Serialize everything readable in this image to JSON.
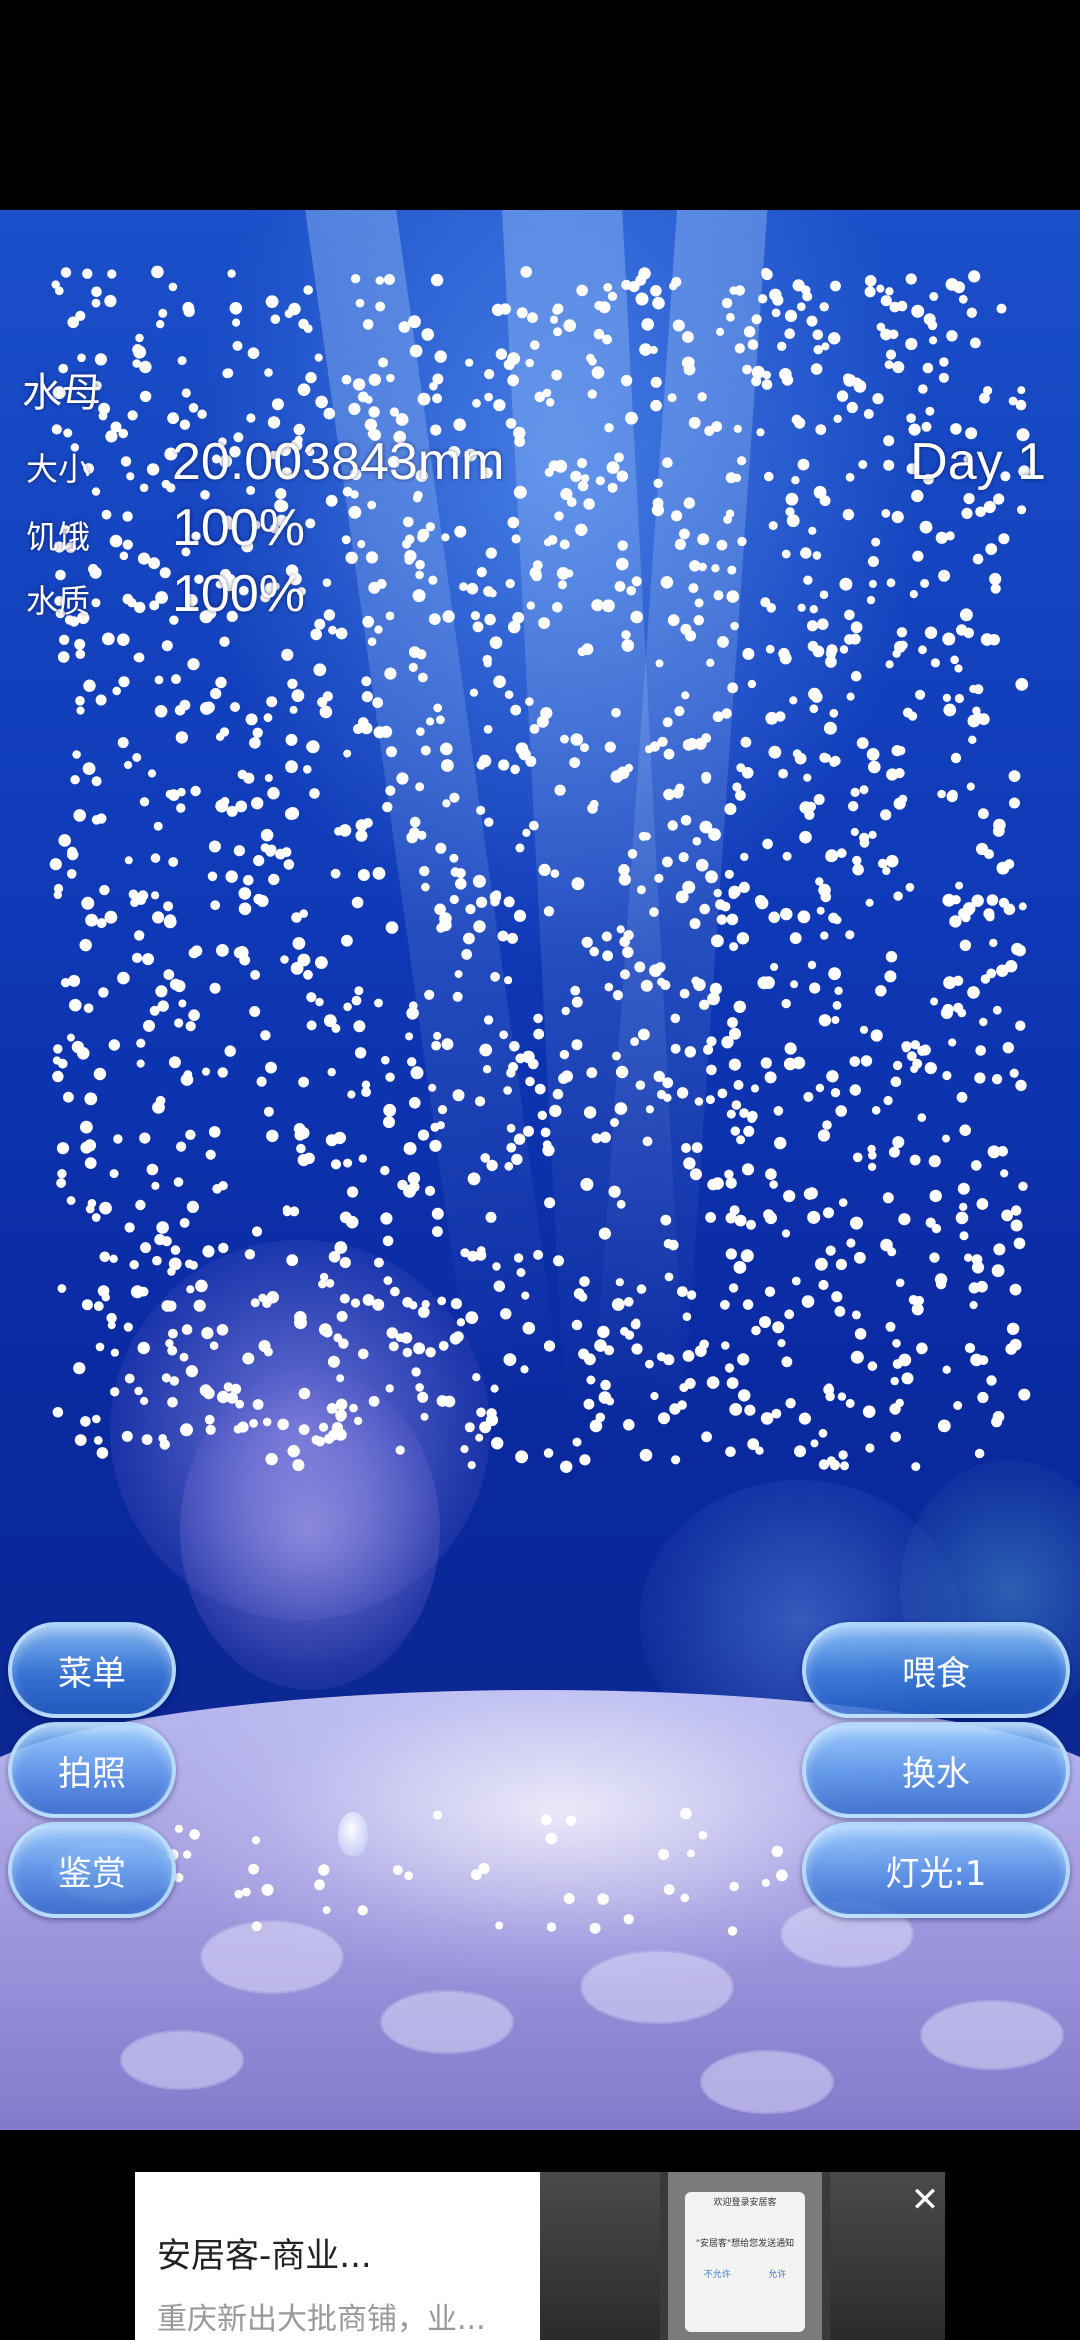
{
  "hud": {
    "title": "水母",
    "size_label": "大小",
    "size_value": "20.003843mm",
    "hunger_label": "饥饿",
    "hunger_value": "100%",
    "water_label": "水质",
    "water_value": "100%",
    "day": "Day 1"
  },
  "buttons": {
    "menu": "菜单",
    "photo": "拍照",
    "view": "鉴赏",
    "feed": "喂食",
    "change_water": "换水",
    "light": "灯光:1"
  },
  "ad": {
    "title": "安居客-商业...",
    "subtitle": "重庆新出大批商铺，业...",
    "dialog_title": "欢迎登录安居客",
    "dialog_notice": "\"安居客\"想给您发送通知",
    "dialog_deny": "不允许",
    "dialog_allow": "允许"
  },
  "colors": {
    "water_top": "#1b4fc9",
    "water_deep": "#0a2aa2",
    "button_border": "#bee1ff",
    "sand": "#a49de0"
  },
  "icons": {
    "close": "close-icon"
  }
}
